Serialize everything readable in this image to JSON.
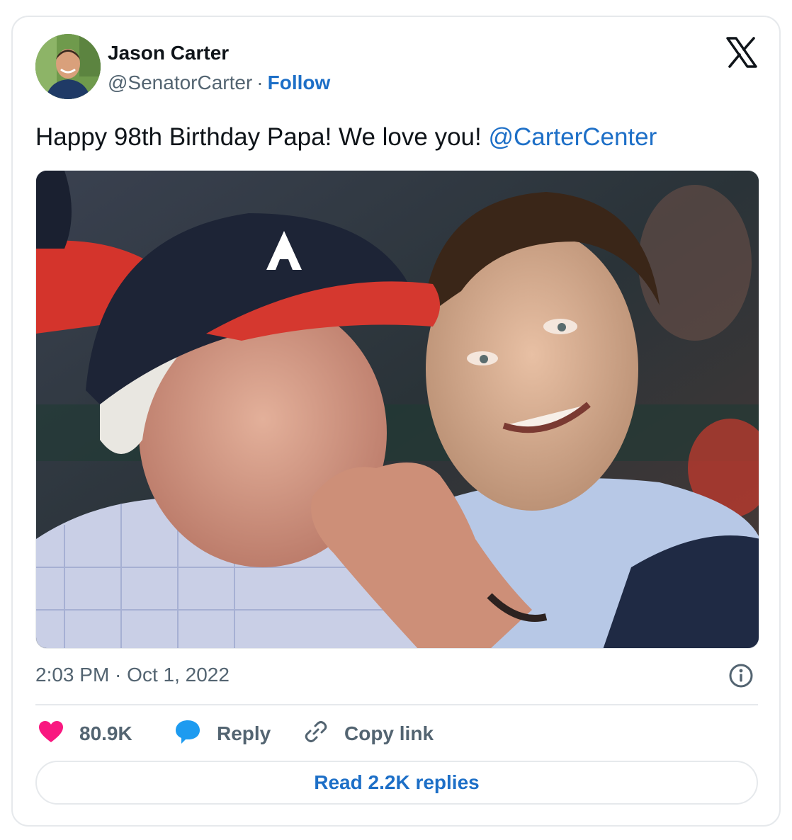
{
  "author": {
    "name": "Jason Carter",
    "handle": "@SenatorCarter",
    "separator": "·",
    "follow_label": "Follow"
  },
  "brand_logo": "x-logo-icon",
  "tweet": {
    "text": "Happy 98th Birthday Papa! We love you! ",
    "mention": "@CarterCenter"
  },
  "meta": {
    "timestamp": "2:03 PM · Oct 1, 2022",
    "info_icon": "info-icon"
  },
  "actions": {
    "likes": "80.9K",
    "like_icon": "heart-icon",
    "reply_label": "Reply",
    "reply_icon": "speech-bubble-icon",
    "copy_label": "Copy link",
    "copy_icon": "link-icon",
    "read_replies_label": "Read 2.2K replies"
  },
  "colors": {
    "link": "#1d6fc7",
    "secondary_text": "#536471",
    "heart": "#f91880",
    "reply_bubble": "#1d9bf0",
    "border": "#e6e9ec"
  }
}
